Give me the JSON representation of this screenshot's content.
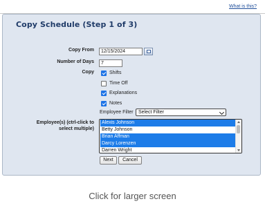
{
  "header": {
    "help_link": "What is this?"
  },
  "panel": {
    "title": "Copy Schedule (Step 1 of 3)"
  },
  "form": {
    "copy_from_label": "Copy From",
    "copy_from_value": "12/15/2024",
    "number_of_days_label": "Number of Days",
    "number_of_days_value": "7",
    "copy_label": "Copy",
    "options": [
      {
        "label": "Shifts",
        "checked": true
      },
      {
        "label": "Time Off",
        "checked": false
      },
      {
        "label": "Explanations",
        "checked": true
      },
      {
        "label": "Notes",
        "checked": true
      }
    ],
    "employee_filter_label": "Employee Filter",
    "employee_filter_value": "Select Filter",
    "employees_label_line1": "Employee(s) (ctrl-click to",
    "employees_label_line2": "select multiple)",
    "employees": [
      {
        "name": "Alexis Johnson",
        "selected": true
      },
      {
        "name": "Betty Johnson",
        "selected": false
      },
      {
        "name": "Brian Affman",
        "selected": true
      },
      {
        "name": "Darcy Lorenzen",
        "selected": true
      },
      {
        "name": "Darren Wright",
        "selected": false
      }
    ]
  },
  "buttons": {
    "next": "Next",
    "cancel": "Cancel"
  },
  "caption": "Click for larger screen",
  "colors": {
    "panel_bg": "#dfe6f0",
    "title": "#1f3b68",
    "selection": "#1d7ce8",
    "link": "#1f4e9a"
  }
}
